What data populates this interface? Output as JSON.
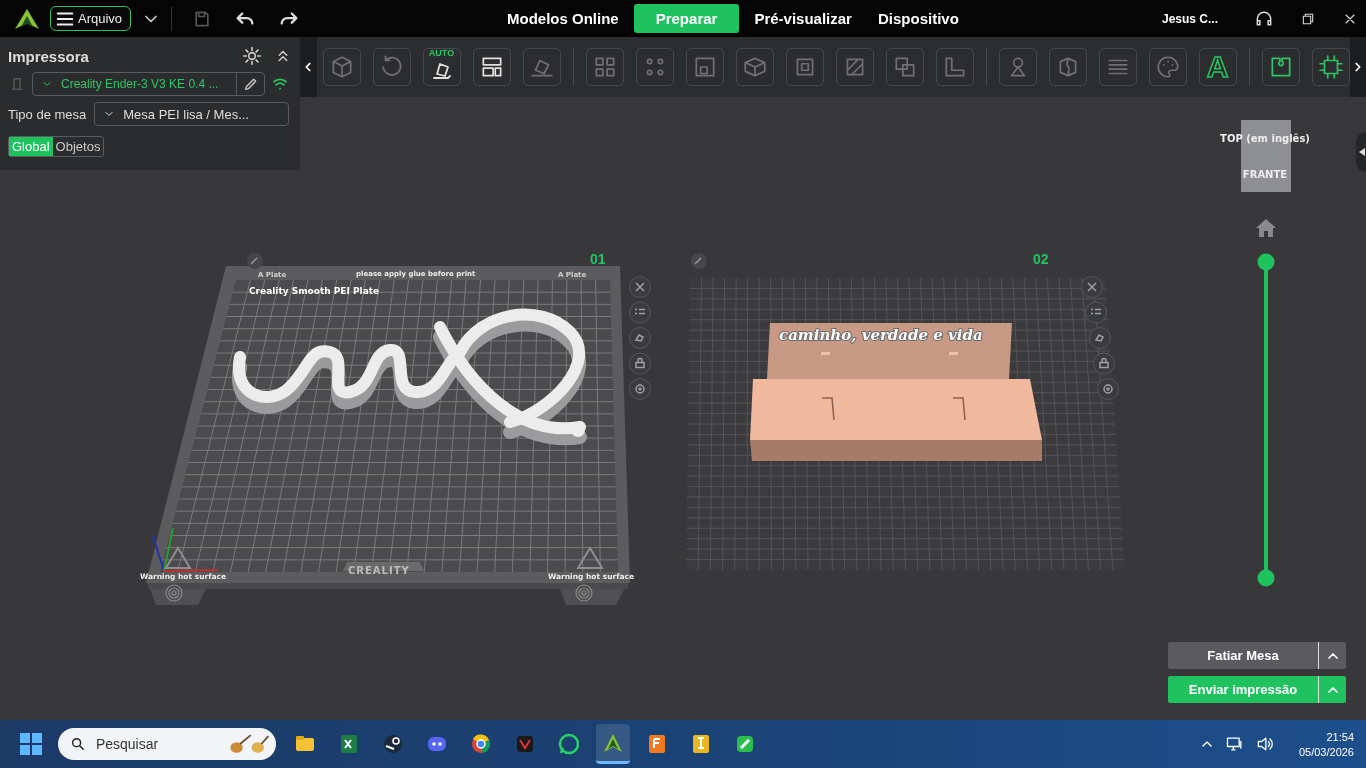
{
  "topbar": {
    "file_menu": "Arquivo",
    "tabs": [
      {
        "label": "Modelos Online",
        "selected": false
      },
      {
        "label": "Preparar",
        "selected": true
      },
      {
        "label": "Pré-visualizar",
        "selected": false
      },
      {
        "label": "Dispositivo",
        "selected": false
      }
    ],
    "user": "Jesus C..."
  },
  "printer_panel": {
    "title": "Impressora",
    "printer": "Creality Ender-3 V3 KE 0.4 ...",
    "bed_label": "Tipo de mesa",
    "bed_type": "Mesa PEI lisa / Mes...",
    "tabs": [
      {
        "label": "Global",
        "selected": true
      },
      {
        "label": "Objetos",
        "selected": false
      }
    ]
  },
  "toolbar": {
    "auto_badge": "AUTO",
    "text_tool": "A"
  },
  "plates": [
    {
      "kind": "textured_bed",
      "number": "01",
      "bed_name": "Creality Smooth PEI Plate",
      "notice": "please apply glue before print",
      "corner_labels": [
        "A Plate",
        "A Plate"
      ],
      "brand": "CREALITY",
      "warnings": [
        "Warning hot surface",
        "Warning hot surface"
      ]
    },
    {
      "kind": "grid_bed",
      "number": "02",
      "model_text": "caminho, verdade e vida"
    }
  ],
  "layer_slider": {
    "level": 1
  },
  "view_cube": {
    "top": "TOP (em inglês)",
    "front": "FRANTE"
  },
  "actions": [
    {
      "label": "Fatiar Mesa",
      "kind": "secondary"
    },
    {
      "label": "Enviar impressão",
      "kind": "primary"
    }
  ],
  "taskbar": {
    "search_placeholder": "Pesquisar",
    "time": "21:54",
    "date": "05/03/2026"
  }
}
